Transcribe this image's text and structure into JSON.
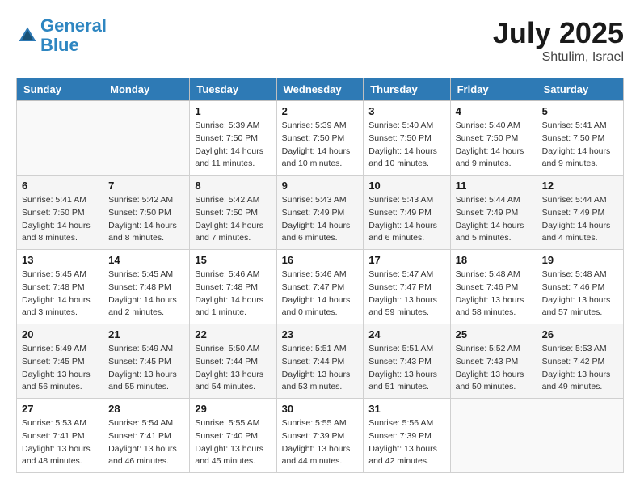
{
  "header": {
    "logo_line1": "General",
    "logo_line2": "Blue",
    "month": "July 2025",
    "location": "Shtulim, Israel"
  },
  "weekdays": [
    "Sunday",
    "Monday",
    "Tuesday",
    "Wednesday",
    "Thursday",
    "Friday",
    "Saturday"
  ],
  "weeks": [
    [
      {
        "day": "",
        "sunrise": "",
        "sunset": "",
        "daylight": ""
      },
      {
        "day": "",
        "sunrise": "",
        "sunset": "",
        "daylight": ""
      },
      {
        "day": "1",
        "sunrise": "Sunrise: 5:39 AM",
        "sunset": "Sunset: 7:50 PM",
        "daylight": "Daylight: 14 hours and 11 minutes."
      },
      {
        "day": "2",
        "sunrise": "Sunrise: 5:39 AM",
        "sunset": "Sunset: 7:50 PM",
        "daylight": "Daylight: 14 hours and 10 minutes."
      },
      {
        "day": "3",
        "sunrise": "Sunrise: 5:40 AM",
        "sunset": "Sunset: 7:50 PM",
        "daylight": "Daylight: 14 hours and 10 minutes."
      },
      {
        "day": "4",
        "sunrise": "Sunrise: 5:40 AM",
        "sunset": "Sunset: 7:50 PM",
        "daylight": "Daylight: 14 hours and 9 minutes."
      },
      {
        "day": "5",
        "sunrise": "Sunrise: 5:41 AM",
        "sunset": "Sunset: 7:50 PM",
        "daylight": "Daylight: 14 hours and 9 minutes."
      }
    ],
    [
      {
        "day": "6",
        "sunrise": "Sunrise: 5:41 AM",
        "sunset": "Sunset: 7:50 PM",
        "daylight": "Daylight: 14 hours and 8 minutes."
      },
      {
        "day": "7",
        "sunrise": "Sunrise: 5:42 AM",
        "sunset": "Sunset: 7:50 PM",
        "daylight": "Daylight: 14 hours and 8 minutes."
      },
      {
        "day": "8",
        "sunrise": "Sunrise: 5:42 AM",
        "sunset": "Sunset: 7:50 PM",
        "daylight": "Daylight: 14 hours and 7 minutes."
      },
      {
        "day": "9",
        "sunrise": "Sunrise: 5:43 AM",
        "sunset": "Sunset: 7:49 PM",
        "daylight": "Daylight: 14 hours and 6 minutes."
      },
      {
        "day": "10",
        "sunrise": "Sunrise: 5:43 AM",
        "sunset": "Sunset: 7:49 PM",
        "daylight": "Daylight: 14 hours and 6 minutes."
      },
      {
        "day": "11",
        "sunrise": "Sunrise: 5:44 AM",
        "sunset": "Sunset: 7:49 PM",
        "daylight": "Daylight: 14 hours and 5 minutes."
      },
      {
        "day": "12",
        "sunrise": "Sunrise: 5:44 AM",
        "sunset": "Sunset: 7:49 PM",
        "daylight": "Daylight: 14 hours and 4 minutes."
      }
    ],
    [
      {
        "day": "13",
        "sunrise": "Sunrise: 5:45 AM",
        "sunset": "Sunset: 7:48 PM",
        "daylight": "Daylight: 14 hours and 3 minutes."
      },
      {
        "day": "14",
        "sunrise": "Sunrise: 5:45 AM",
        "sunset": "Sunset: 7:48 PM",
        "daylight": "Daylight: 14 hours and 2 minutes."
      },
      {
        "day": "15",
        "sunrise": "Sunrise: 5:46 AM",
        "sunset": "Sunset: 7:48 PM",
        "daylight": "Daylight: 14 hours and 1 minute."
      },
      {
        "day": "16",
        "sunrise": "Sunrise: 5:46 AM",
        "sunset": "Sunset: 7:47 PM",
        "daylight": "Daylight: 14 hours and 0 minutes."
      },
      {
        "day": "17",
        "sunrise": "Sunrise: 5:47 AM",
        "sunset": "Sunset: 7:47 PM",
        "daylight": "Daylight: 13 hours and 59 minutes."
      },
      {
        "day": "18",
        "sunrise": "Sunrise: 5:48 AM",
        "sunset": "Sunset: 7:46 PM",
        "daylight": "Daylight: 13 hours and 58 minutes."
      },
      {
        "day": "19",
        "sunrise": "Sunrise: 5:48 AM",
        "sunset": "Sunset: 7:46 PM",
        "daylight": "Daylight: 13 hours and 57 minutes."
      }
    ],
    [
      {
        "day": "20",
        "sunrise": "Sunrise: 5:49 AM",
        "sunset": "Sunset: 7:45 PM",
        "daylight": "Daylight: 13 hours and 56 minutes."
      },
      {
        "day": "21",
        "sunrise": "Sunrise: 5:49 AM",
        "sunset": "Sunset: 7:45 PM",
        "daylight": "Daylight: 13 hours and 55 minutes."
      },
      {
        "day": "22",
        "sunrise": "Sunrise: 5:50 AM",
        "sunset": "Sunset: 7:44 PM",
        "daylight": "Daylight: 13 hours and 54 minutes."
      },
      {
        "day": "23",
        "sunrise": "Sunrise: 5:51 AM",
        "sunset": "Sunset: 7:44 PM",
        "daylight": "Daylight: 13 hours and 53 minutes."
      },
      {
        "day": "24",
        "sunrise": "Sunrise: 5:51 AM",
        "sunset": "Sunset: 7:43 PM",
        "daylight": "Daylight: 13 hours and 51 minutes."
      },
      {
        "day": "25",
        "sunrise": "Sunrise: 5:52 AM",
        "sunset": "Sunset: 7:43 PM",
        "daylight": "Daylight: 13 hours and 50 minutes."
      },
      {
        "day": "26",
        "sunrise": "Sunrise: 5:53 AM",
        "sunset": "Sunset: 7:42 PM",
        "daylight": "Daylight: 13 hours and 49 minutes."
      }
    ],
    [
      {
        "day": "27",
        "sunrise": "Sunrise: 5:53 AM",
        "sunset": "Sunset: 7:41 PM",
        "daylight": "Daylight: 13 hours and 48 minutes."
      },
      {
        "day": "28",
        "sunrise": "Sunrise: 5:54 AM",
        "sunset": "Sunset: 7:41 PM",
        "daylight": "Daylight: 13 hours and 46 minutes."
      },
      {
        "day": "29",
        "sunrise": "Sunrise: 5:55 AM",
        "sunset": "Sunset: 7:40 PM",
        "daylight": "Daylight: 13 hours and 45 minutes."
      },
      {
        "day": "30",
        "sunrise": "Sunrise: 5:55 AM",
        "sunset": "Sunset: 7:39 PM",
        "daylight": "Daylight: 13 hours and 44 minutes."
      },
      {
        "day": "31",
        "sunrise": "Sunrise: 5:56 AM",
        "sunset": "Sunset: 7:39 PM",
        "daylight": "Daylight: 13 hours and 42 minutes."
      },
      {
        "day": "",
        "sunrise": "",
        "sunset": "",
        "daylight": ""
      },
      {
        "day": "",
        "sunrise": "",
        "sunset": "",
        "daylight": ""
      }
    ]
  ]
}
